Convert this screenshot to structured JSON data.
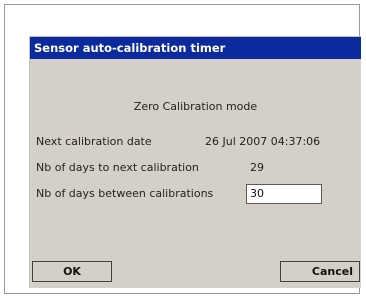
{
  "dialog": {
    "title": "Sensor auto-calibration timer",
    "mode_text": "Zero Calibration mode",
    "rows": [
      {
        "label": "Next calibration date",
        "value": "26 Jul 2007 04:37:06"
      },
      {
        "label": "Nb of days to next calibration",
        "value": "29"
      },
      {
        "label": "Nb of days between calibrations",
        "value": "30"
      }
    ],
    "ok_label": "OK",
    "cancel_label": "Cancel"
  },
  "colors": {
    "titlebar": "#0a2a9e",
    "dialog_bg": "#d4d0c8"
  }
}
